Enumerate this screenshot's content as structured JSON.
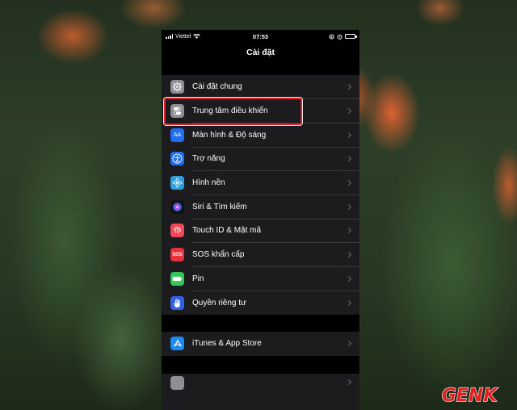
{
  "status_bar": {
    "carrier": "Viettel",
    "time": "07:53"
  },
  "nav": {
    "title": "Cài đặt"
  },
  "groups": [
    {
      "items": [
        {
          "label": "Cài đặt chung",
          "icon": "gear-icon",
          "color": "#8e8e93"
        },
        {
          "label": "Trung tâm điều khiển",
          "icon": "toggles-icon",
          "color": "#8e8e93"
        },
        {
          "label": "Màn hình & Độ sáng",
          "icon": "aa-icon",
          "color": "#1e6ff5",
          "glyph": "AA"
        },
        {
          "label": "Trợ năng",
          "icon": "accessibility-icon",
          "color": "#1e6ff5"
        },
        {
          "label": "Hình nền",
          "icon": "wallpaper-flower-icon",
          "color": "#2d9ede"
        },
        {
          "label": "Siri & Tìm kiếm",
          "icon": "siri-icon",
          "color": "#222"
        },
        {
          "label": "Touch ID & Mật mã",
          "icon": "fingerprint-icon",
          "color": "#f2485a"
        },
        {
          "label": "SOS khẩn cấp",
          "icon": "sos-icon",
          "color": "#e8303a",
          "glyph": "SOS"
        },
        {
          "label": "Pin",
          "icon": "battery-icon",
          "color": "#34c759"
        },
        {
          "label": "Quyền riêng tư",
          "icon": "hand-icon",
          "color": "#2f62e6"
        }
      ]
    },
    {
      "items": [
        {
          "label": "iTunes & App Store",
          "icon": "app-store-icon",
          "color": "#1a8cf7"
        }
      ]
    }
  ],
  "highlighted_item": "Trung tâm điều khiển",
  "watermark": {
    "text": "GENK"
  }
}
